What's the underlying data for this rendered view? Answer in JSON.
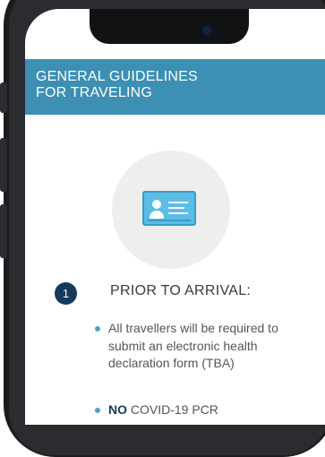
{
  "header": {
    "title": "GENERAL GUIDELINES\nFOR TRAVELING"
  },
  "hero": {
    "icon": "id-card-icon"
  },
  "step": {
    "number": "1",
    "title": "PRIOR TO ARRIVAL:"
  },
  "bullets": [
    {
      "text": "All travellers will be required to submit an electronic health declaration form (TBA)"
    },
    {
      "emphasis": "NO",
      "rest": " COVID-19 PCR"
    }
  ],
  "colors": {
    "header_bg": "#3d8fb4",
    "badge_bg": "#153a5b",
    "bullet_dot": "#4aa3c8",
    "icon_card": "#5bbde6"
  }
}
